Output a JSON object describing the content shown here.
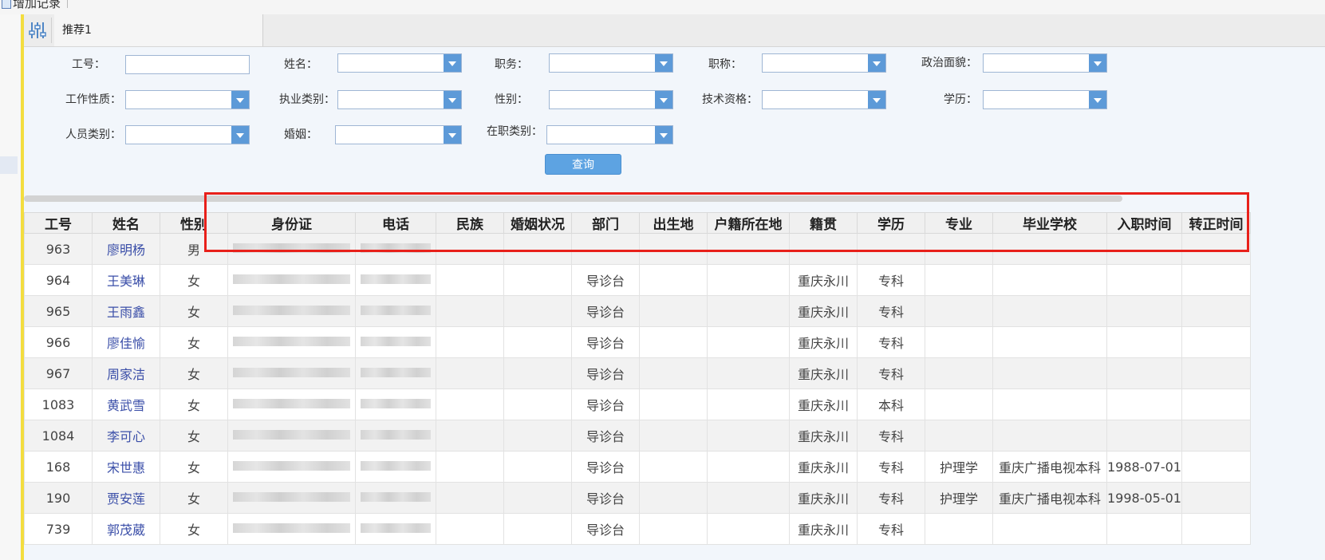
{
  "toolbar": {
    "add_record": "增加记录"
  },
  "tab": {
    "label": "推荐1",
    "icon": "sliders-icon"
  },
  "form": {
    "row1": [
      {
        "label": "工号：",
        "type": "text",
        "value": ""
      },
      {
        "label": "姓名：",
        "type": "combo",
        "value": ""
      },
      {
        "label": "职务：",
        "type": "combo",
        "value": ""
      },
      {
        "label": "职称：",
        "type": "combo",
        "value": ""
      },
      {
        "label": "政治面貌：",
        "type": "combo",
        "value": ""
      }
    ],
    "row2": [
      {
        "label": "工作性质：",
        "type": "combo",
        "value": ""
      },
      {
        "label": "执业类别：",
        "type": "combo",
        "value": ""
      },
      {
        "label": "性别：",
        "type": "combo",
        "value": ""
      },
      {
        "label": "技术资格：",
        "type": "combo",
        "value": ""
      },
      {
        "label": "学历：",
        "type": "combo",
        "value": ""
      }
    ],
    "row3": [
      {
        "label": "人员类别：",
        "type": "combo",
        "value": ""
      },
      {
        "label": "婚姻：",
        "type": "combo",
        "value": ""
      },
      {
        "label": "在职类别：",
        "type": "combo",
        "value": ""
      }
    ],
    "query_button": "查询"
  },
  "colors": {
    "accent": "#5da3e2",
    "highlight": "#e8201a",
    "link": "#3a4ea8",
    "side_bar": "#f3dd3f"
  },
  "table": {
    "columns": [
      "工号",
      "姓名",
      "性别",
      "身份证",
      "电话",
      "民族",
      "婚姻状况",
      "部门",
      "出生地",
      "户籍所在地",
      "籍贯",
      "学历",
      "专业",
      "毕业学校",
      "入职时间",
      "转正时间"
    ],
    "rows": [
      [
        "963",
        "廖明杨",
        "男",
        "",
        "",
        "",
        "",
        "",
        "",
        "",
        "",
        "",
        "",
        "",
        "",
        ""
      ],
      [
        "964",
        "王美琳",
        "女",
        "",
        "",
        "",
        "",
        "导诊台",
        "",
        "",
        "重庆永川",
        "专科",
        "",
        "",
        "",
        ""
      ],
      [
        "965",
        "王雨鑫",
        "女",
        "",
        "",
        "",
        "",
        "导诊台",
        "",
        "",
        "重庆永川",
        "专科",
        "",
        "",
        "",
        ""
      ],
      [
        "966",
        "廖佳愉",
        "女",
        "",
        "",
        "",
        "",
        "导诊台",
        "",
        "",
        "重庆永川",
        "专科",
        "",
        "",
        "",
        ""
      ],
      [
        "967",
        "周家洁",
        "女",
        "",
        "",
        "",
        "",
        "导诊台",
        "",
        "",
        "重庆永川",
        "专科",
        "",
        "",
        "",
        ""
      ],
      [
        "1083",
        "黄武雪",
        "女",
        "",
        "",
        "",
        "",
        "导诊台",
        "",
        "",
        "重庆永川",
        "本科",
        "",
        "",
        "",
        ""
      ],
      [
        "1084",
        "李可心",
        "女",
        "",
        "",
        "",
        "",
        "导诊台",
        "",
        "",
        "重庆永川",
        "专科",
        "",
        "",
        "",
        ""
      ],
      [
        "168",
        "宋世惠",
        "女",
        "",
        "",
        "",
        "",
        "导诊台",
        "",
        "",
        "重庆永川",
        "专科",
        "护理学",
        "重庆广播电视本科",
        "1988-07-01",
        ""
      ],
      [
        "190",
        "贾安莲",
        "女",
        "",
        "",
        "",
        "",
        "导诊台",
        "",
        "",
        "重庆永川",
        "专科",
        "护理学",
        "重庆广播电视本科",
        "1998-05-01",
        ""
      ],
      [
        "739",
        "郭茂葳",
        "女",
        "",
        "",
        "",
        "",
        "导诊台",
        "",
        "",
        "重庆永川",
        "专科",
        "",
        "",
        "",
        ""
      ]
    ],
    "blurred_columns": [
      "身份证",
      "电话"
    ]
  }
}
